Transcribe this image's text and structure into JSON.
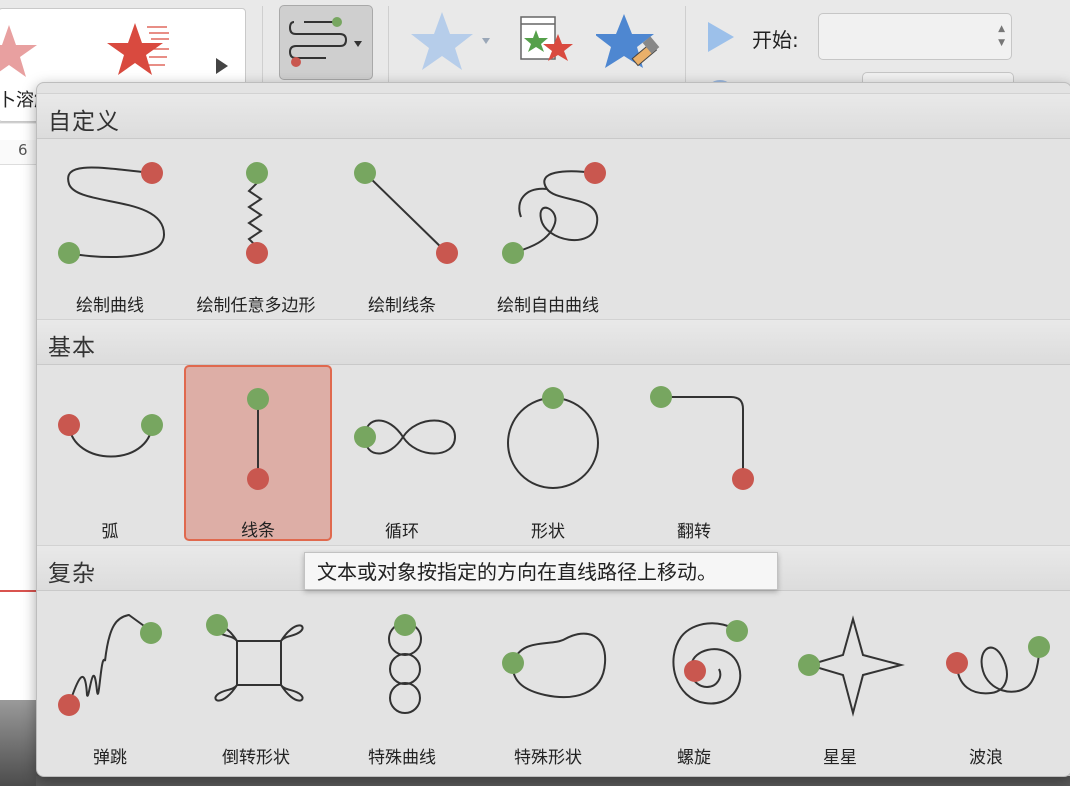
{
  "ribbon": {
    "gallery_label": "卜溶解",
    "start_label": "开始:",
    "ruler_number": "6"
  },
  "panel": {
    "sections": [
      {
        "title": "自定义",
        "items": [
          "绘制曲线",
          "绘制任意多边形",
          "绘制线条",
          "绘制自由曲线"
        ]
      },
      {
        "title": "基本",
        "items": [
          "弧",
          "线条",
          "循环",
          "形状",
          "翻转"
        ]
      },
      {
        "title": "复杂",
        "items": [
          "弹跳",
          "倒转形状",
          "特殊曲线",
          "特殊形状",
          "螺旋",
          "星星",
          "波浪"
        ]
      }
    ],
    "selected_item": "线条"
  },
  "tooltip": "文本或对象按指定的方向在直线路径上移动。",
  "colors": {
    "start_dot": "#77a660",
    "end_dot": "#c9574f",
    "selected_bg": "#ddaea6",
    "selected_border": "#e0694e"
  }
}
